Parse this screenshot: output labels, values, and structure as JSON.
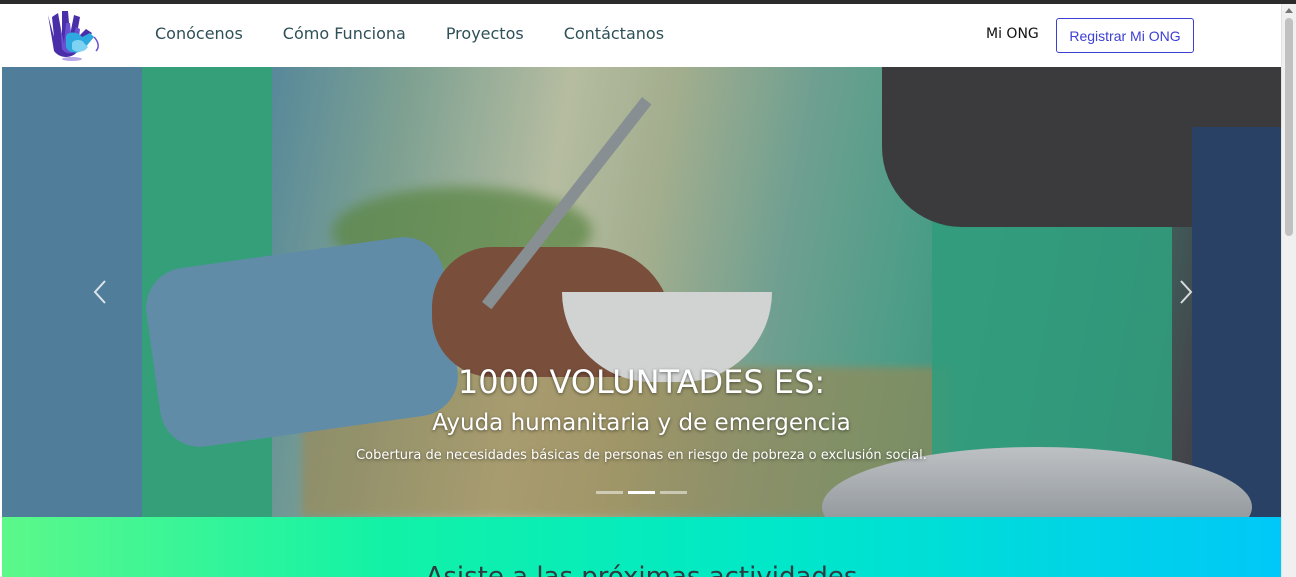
{
  "navbar": {
    "logo_name": "hands-logo",
    "links": [
      "Conócenos",
      "Cómo Funciona",
      "Proyectos",
      "Contáctanos"
    ],
    "mi_ong": "Mi ONG",
    "register_label": "Registrar Mi ONG"
  },
  "carousel": {
    "title": "1000 VOLUNTADES ES:",
    "subtitle": "Ayuda humanitaria y de emergencia",
    "text": "Cobertura de necesidades básicas de personas en riesgo de pobreza o exclusión social.",
    "slides_count": 3,
    "active_slide": 2,
    "prev_icon": "chevron-left-icon",
    "next_icon": "chevron-right-icon"
  },
  "section": {
    "title": "Asiste a las próximas actividades"
  },
  "colors": {
    "nav_text": "#2e5058",
    "register_accent": "#3b3fd3",
    "gradient_start": "#5cf88a",
    "gradient_end": "#00c8f8"
  }
}
